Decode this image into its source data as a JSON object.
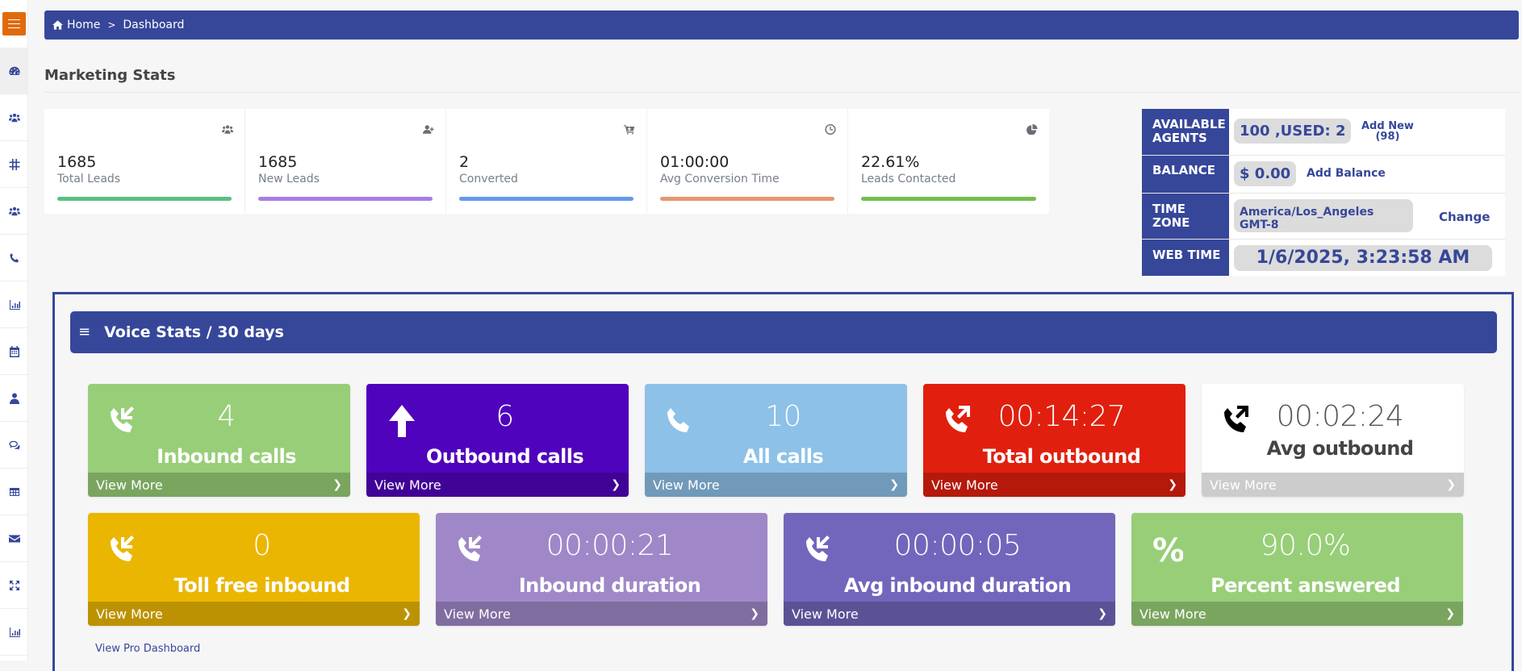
{
  "sidebar": {
    "toggle_icon": "hamburger-icon",
    "items": [
      {
        "name": "dashboard",
        "icon": "tachometer-icon",
        "active": true
      },
      {
        "name": "users",
        "icon": "users-icon"
      },
      {
        "name": "numbers",
        "icon": "hashtag-icon"
      },
      {
        "name": "groups",
        "icon": "users-icon"
      },
      {
        "name": "calls",
        "icon": "phone-icon"
      },
      {
        "name": "reports",
        "icon": "bar-chart-icon"
      },
      {
        "name": "calendar",
        "icon": "calendar-icon"
      },
      {
        "name": "agents",
        "icon": "user-md-icon"
      },
      {
        "name": "chat",
        "icon": "comments-icon"
      },
      {
        "name": "table",
        "icon": "table-icon"
      },
      {
        "name": "email",
        "icon": "envelope-icon"
      },
      {
        "name": "expand",
        "icon": "expand-icon"
      },
      {
        "name": "analytics",
        "icon": "bar-chart-icon"
      }
    ]
  },
  "breadcrumb": {
    "home": "Home",
    "separator": ">",
    "current": "Dashboard"
  },
  "page_title": "Marketing Stats",
  "marketing": [
    {
      "value": "1685",
      "label": "Total Leads",
      "icon": "users-icon",
      "color": "#5bc07f"
    },
    {
      "value": "1685",
      "label": "New Leads",
      "icon": "user-plus-icon",
      "color": "#a77fe0"
    },
    {
      "value": "2",
      "label": "Converted",
      "icon": "cart-plus-icon",
      "color": "#6399ec"
    },
    {
      "value": "01:00:00",
      "label": "Avg Conversion Time",
      "icon": "clock-icon",
      "color": "#e69670"
    },
    {
      "value": "22.61%",
      "label": "Leads Contacted",
      "icon": "pie-chart-icon",
      "color": "#72bf50"
    }
  ],
  "account": {
    "agents": {
      "label_1": "AVAILABLE",
      "label_2": "AGENTS",
      "value": "100 ,USED: 2",
      "action_1": "Add New",
      "action_2": "(98)"
    },
    "balance": {
      "label": "BALANCE",
      "value": "$ 0.00",
      "action": "Add Balance"
    },
    "timezone": {
      "label_1": "TIME",
      "label_2": "ZONE",
      "value": "America/Los_Angeles GMT-8",
      "action": "Change"
    },
    "webtime": {
      "label": "WEB TIME",
      "value": "1/6/2025, 3:23:58 AM"
    }
  },
  "voice": {
    "title": "Voice Stats / 30 days",
    "menu_icon": "bars-icon",
    "view_more": "View More",
    "tiles": [
      {
        "value": "4",
        "label": "Inbound calls",
        "icon": "phone-inbound-icon",
        "bg": "#98ce78",
        "footer": "#7aa55f"
      },
      {
        "value": "6",
        "label": "Outbound calls",
        "icon": "arrow-up-icon",
        "bg": "#5003bc",
        "footer": "#410396"
      },
      {
        "value": "10",
        "label": "All calls",
        "icon": "phone-icon",
        "bg": "#8dc1e8",
        "footer": "#719aba"
      },
      {
        "value": "00:14:27",
        "label": "Total outbound",
        "icon": "phone-outbound-icon",
        "bg": "#e11f0e",
        "footer": "#b4190b"
      },
      {
        "value": "00:02:24",
        "label": "Avg outbound",
        "icon": "phone-outbound-icon",
        "bg": "#ffffff",
        "footer": "#cccccc"
      },
      {
        "value": "0",
        "label": "Toll free inbound",
        "icon": "phone-inbound-icon",
        "bg": "#ebb602",
        "footer": "#bc9202"
      },
      {
        "value": "00:00:21",
        "label": "Inbound duration",
        "icon": "phone-inbound-icon",
        "bg": "#a088c8",
        "footer": "#806da0"
      },
      {
        "value": "00:00:05",
        "label": "Avg inbound duration",
        "icon": "phone-inbound-icon",
        "bg": "#7266bc",
        "footer": "#5b5296"
      },
      {
        "value": "90.0%",
        "label": "Percent answered",
        "icon": "percent-icon",
        "bg": "#98ce78",
        "footer": "#7aa55f"
      }
    ],
    "pro_link": "View Pro Dashboard"
  },
  "colors": {
    "brand": "#36479a",
    "toggle": "#e06a0a"
  }
}
